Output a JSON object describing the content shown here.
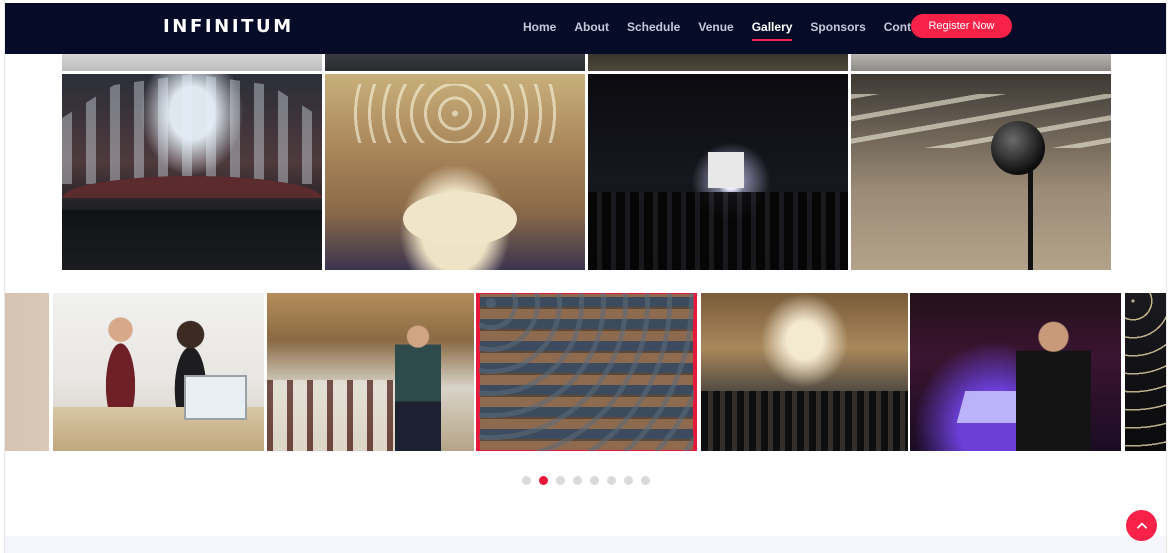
{
  "brand": {
    "logo_text": "INFINITUM"
  },
  "nav": {
    "items": [
      {
        "label": "Home",
        "active": false
      },
      {
        "label": "About",
        "active": false
      },
      {
        "label": "Schedule",
        "active": false
      },
      {
        "label": "Venue",
        "active": false
      },
      {
        "label": "Gallery",
        "active": true
      },
      {
        "label": "Sponsors",
        "active": false
      },
      {
        "label": "Contact",
        "active": false
      }
    ],
    "cta_label": "Register Now"
  },
  "gallery": {
    "grid_images": [
      {
        "name": "memorial-hall-photo"
      },
      {
        "name": "ballroom-photo"
      },
      {
        "name": "concert-photo"
      },
      {
        "name": "expo-hall-microphone-photo"
      }
    ],
    "carousel": {
      "slides": [
        {
          "name": "edge-slide-left"
        },
        {
          "name": "office-meeting-photo"
        },
        {
          "name": "cafe-talk-photo"
        },
        {
          "name": "auditorium-audience-photo",
          "active": true
        },
        {
          "name": "arcade-hall-crowd-photo"
        },
        {
          "name": "hackathon-photo"
        },
        {
          "name": "edge-slide-right"
        }
      ],
      "dot_count": 8,
      "active_dot_index": 1
    }
  },
  "colors": {
    "accent": "#f82249",
    "nav_bg": "#060c28",
    "active_outline": "#e6193b",
    "dot_inactive": "#dadada"
  },
  "icons": {
    "back_to_top": "chevron-up-icon"
  }
}
